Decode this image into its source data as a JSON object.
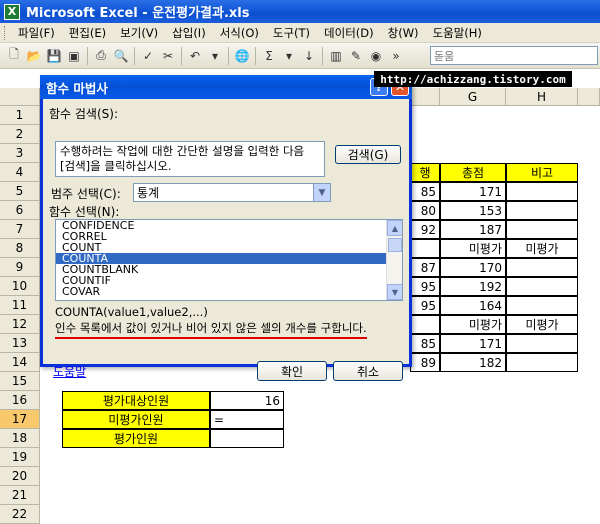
{
  "window": {
    "app_icon": "X",
    "title": "Microsoft Excel - 운전평가결과.xls"
  },
  "menu": [
    "파일(F)",
    "편집(E)",
    "보기(V)",
    "삽입(I)",
    "서식(O)",
    "도구(T)",
    "데이터(D)",
    "창(W)",
    "도움말(H)"
  ],
  "toolbar": {
    "font_name": "돋움",
    "sum_symbol": "Σ"
  },
  "watermark": "http://achizzang.tistory.com",
  "sheet": {
    "columns": [
      "G",
      "H"
    ],
    "rows": [
      "1",
      "2",
      "3",
      "4",
      "5",
      "6",
      "7",
      "8",
      "9",
      "10",
      "11",
      "12",
      "13",
      "14",
      "15",
      "16",
      "17",
      "18",
      "19",
      "20",
      "21",
      "22"
    ],
    "active_row": "17",
    "header_row": {
      "partial": "행",
      "total": "총점",
      "remark": "비고"
    },
    "cells": [
      {
        "row": 5,
        "f": "85",
        "g": "171",
        "h": ""
      },
      {
        "row": 6,
        "f": "80",
        "g": "153",
        "h": ""
      },
      {
        "row": 7,
        "f": "92",
        "g": "187",
        "h": ""
      },
      {
        "row": 8,
        "f": "",
        "g": "미평가",
        "h": "미평가"
      },
      {
        "row": 9,
        "f": "87",
        "g": "170",
        "h": ""
      },
      {
        "row": 10,
        "f": "95",
        "g": "192",
        "h": ""
      },
      {
        "row": 11,
        "f": "95",
        "g": "164",
        "h": ""
      },
      {
        "row": 12,
        "f": "",
        "g": "미평가",
        "h": "미평가"
      },
      {
        "row": 13,
        "f": "85",
        "g": "171",
        "h": ""
      },
      {
        "row": 14,
        "f": "89",
        "g": "182",
        "h": ""
      }
    ],
    "row16_partial_label": "평가대상인원",
    "row16_partial_value": "16",
    "row17_label": "미평가인원",
    "row17_value": "=",
    "row18_label": "평가인원"
  },
  "dialog": {
    "title": "함수 마법사",
    "search_label": "함수 검색(S):",
    "search_text": "수행하려는 작업에 대한 간단한 설명을 입력한 다음 [검색]을 클릭하십시오.",
    "search_button": "검색(G)",
    "category_label": "범주 선택(C):",
    "category_value": "통계",
    "function_label": "함수 선택(N):",
    "functions": [
      "CONFIDENCE",
      "CORREL",
      "COUNT",
      "COUNTA",
      "COUNTBLANK",
      "COUNTIF",
      "COVAR"
    ],
    "selected_function": "COUNTA",
    "syntax": "COUNTA(value1,value2,...)",
    "description": "인수 목록에서 값이 있거나 비어 있지 않은 셀의 개수를 구합니다.",
    "help_link": "도움말",
    "ok_button": "확인",
    "cancel_button": "취소"
  }
}
